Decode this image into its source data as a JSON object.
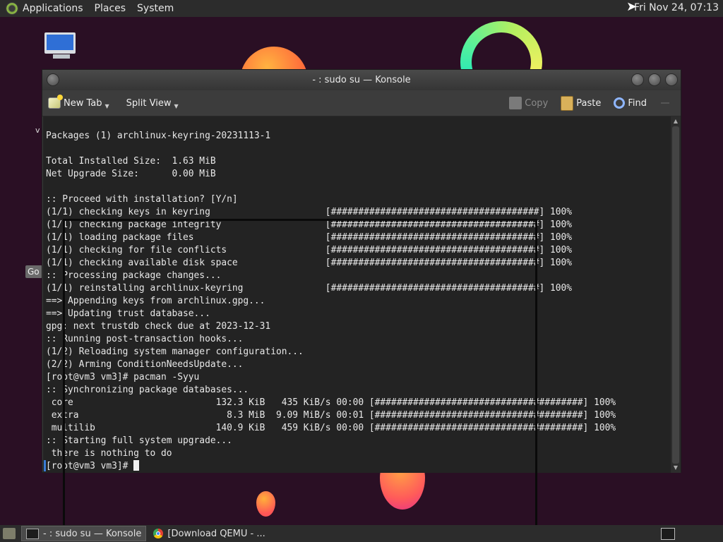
{
  "top_panel": {
    "menus": [
      "Applications",
      "Places",
      "System"
    ],
    "clock": "Fri Nov 24, 07:13"
  },
  "desktop": {
    "side_label": "v",
    "go_chip": "Go"
  },
  "window": {
    "title": "- : sudo su — Konsole",
    "toolbar": {
      "new_tab": "New Tab",
      "split_view": "Split View",
      "copy": "Copy",
      "paste": "Paste",
      "find": "Find"
    }
  },
  "terminal": {
    "lines": [
      "Packages (1) archlinux-keyring-20231113-1",
      "",
      "Total Installed Size:  1.63 MiB",
      "Net Upgrade Size:      0.00 MiB",
      "",
      ":: Proceed with installation? [Y/n]",
      "(1/1) checking keys in keyring                     [######################################] 100%",
      "(1/1) checking package integrity                   [######################################] 100%",
      "(1/1) loading package files                        [######################################] 100%",
      "(1/1) checking for file conflicts                  [######################################] 100%",
      "(1/1) checking available disk space                [######################################] 100%",
      ":: Processing package changes...",
      "(1/1) reinstalling archlinux-keyring               [######################################] 100%",
      "==> Appending keys from archlinux.gpg...",
      "==> Updating trust database...",
      "gpg: next trustdb check due at 2023-12-31",
      ":: Running post-transaction hooks...",
      "(1/2) Reloading system manager configuration...",
      "(2/2) Arming ConditionNeedsUpdate...",
      "[root@vm3 vm3]# pacman -Syyu",
      ":: Synchronizing package databases...",
      " core                          132.3 KiB   435 KiB/s 00:00 [######################################] 100%",
      " extra                           8.3 MiB  9.09 MiB/s 00:01 [######################################] 100%",
      " multilib                      140.9 KiB   459 KiB/s 00:00 [######################################] 100%",
      ":: Starting full system upgrade...",
      " there is nothing to do"
    ],
    "prompt": "[root@vm3 vm3]# "
  },
  "taskbar": {
    "tasks": [
      "- : sudo su — Konsole",
      "[Download QEMU - ..."
    ]
  }
}
